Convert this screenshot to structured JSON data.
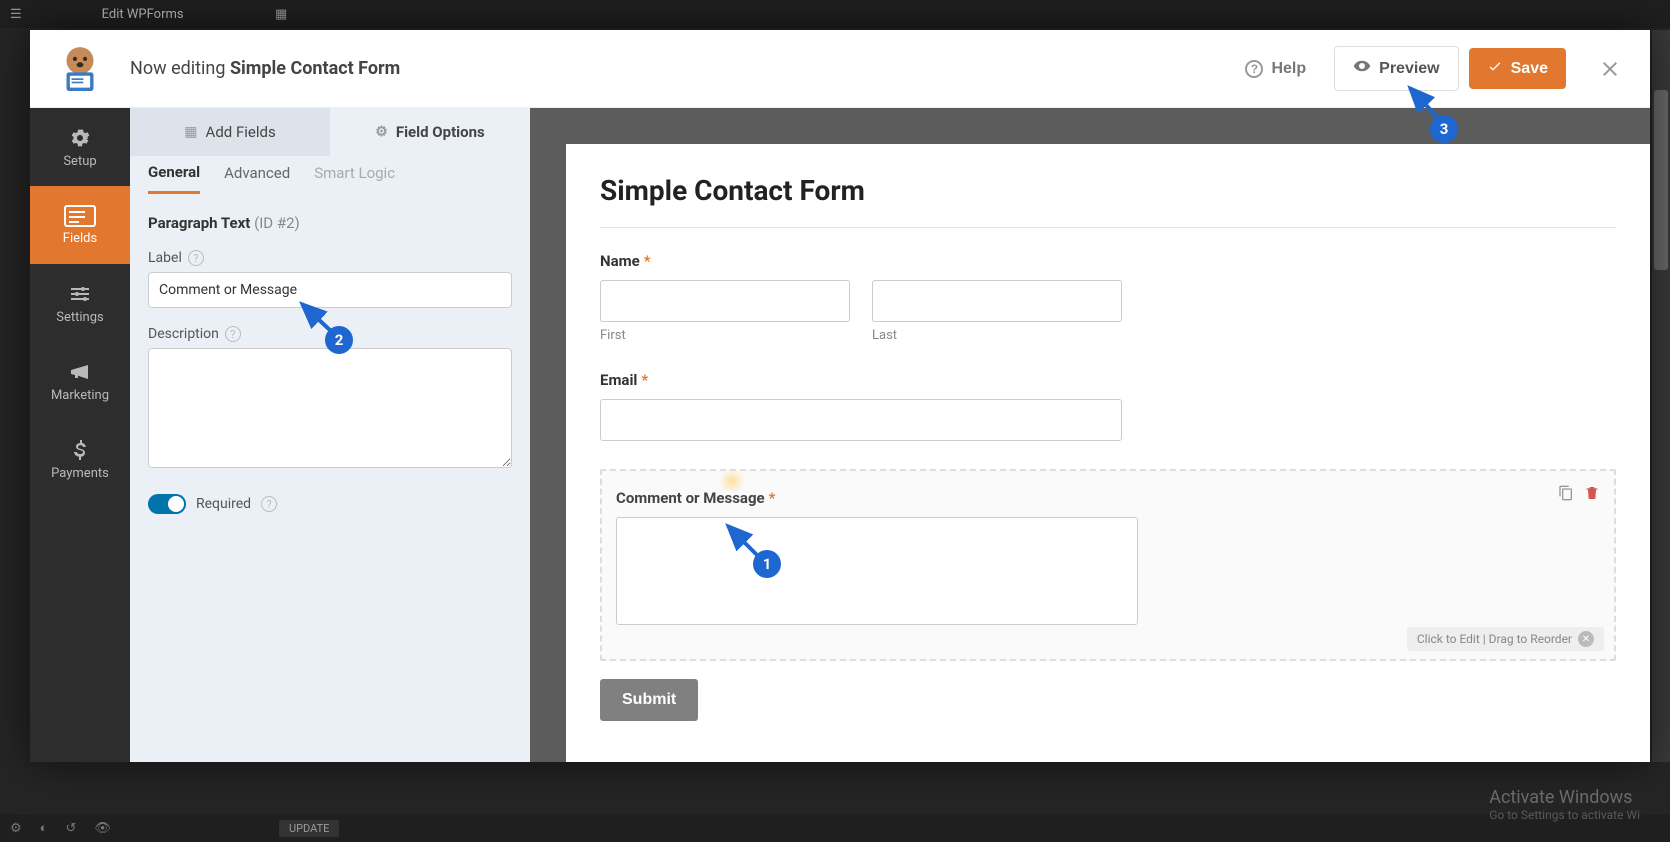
{
  "wp": {
    "title": "Edit WPForms"
  },
  "topbar": {
    "now_editing": "Now editing",
    "form_name": "Simple Contact Form",
    "help": "Help",
    "preview": "Preview",
    "save": "Save"
  },
  "leftnav": {
    "setup": "Setup",
    "fields": "Fields",
    "settings": "Settings",
    "marketing": "Marketing",
    "payments": "Payments"
  },
  "tabs": {
    "add_fields": "Add Fields",
    "field_options": "Field Options"
  },
  "subtabs": {
    "general": "General",
    "advanced": "Advanced",
    "smart_logic": "Smart Logic"
  },
  "field_options": {
    "title": "Paragraph Text",
    "id_label": "(ID #2)",
    "label_label": "Label",
    "label_value": "Comment or Message",
    "description_label": "Description",
    "description_value": "",
    "required_label": "Required"
  },
  "preview": {
    "form_title": "Simple Contact Form",
    "name_label": "Name",
    "first": "First",
    "last": "Last",
    "email_label": "Email",
    "comment_label": "Comment or Message",
    "hint": "Click to Edit | Drag to Reorder",
    "submit": "Submit"
  },
  "annotations": {
    "a1": "1",
    "a2": "2",
    "a3": "3"
  },
  "watermark": {
    "t": "Activate Windows",
    "s": "Go to Settings to activate Wi"
  },
  "bottom": {
    "update": "UPDATE"
  }
}
